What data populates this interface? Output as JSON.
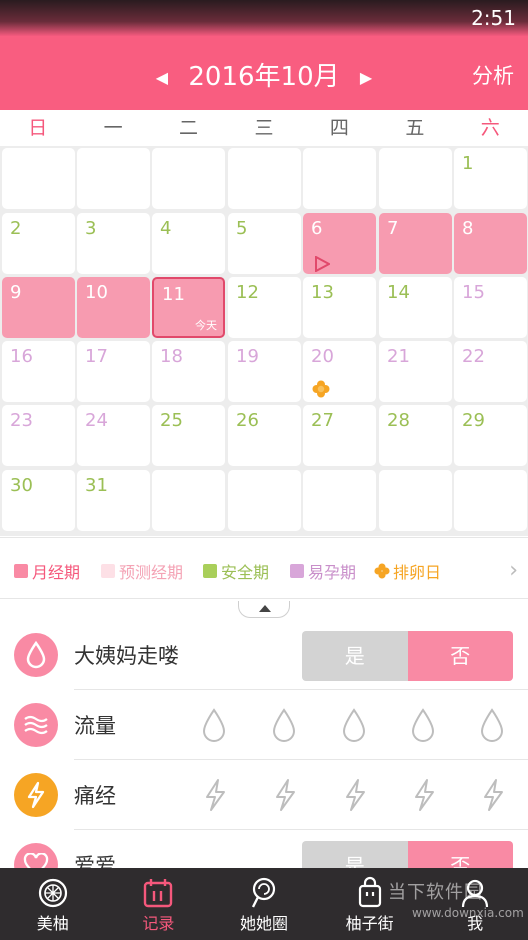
{
  "status_bar": {
    "time": "2:51"
  },
  "header": {
    "prev": "◀",
    "title": "2016年10月",
    "next": "▶",
    "analysis": "分析"
  },
  "weekdays": [
    "日",
    "一",
    "二",
    "三",
    "四",
    "五",
    "六"
  ],
  "calendar": {
    "today_label": "今天",
    "cells": [
      {
        "day": "1",
        "type": "green"
      },
      {
        "day": "2",
        "type": "green"
      },
      {
        "day": "3",
        "type": "green"
      },
      {
        "day": "4",
        "type": "green"
      },
      {
        "day": "5",
        "type": "green"
      },
      {
        "day": "6",
        "type": "period",
        "flag": true
      },
      {
        "day": "7",
        "type": "period"
      },
      {
        "day": "8",
        "type": "period"
      },
      {
        "day": "9",
        "type": "period"
      },
      {
        "day": "10",
        "type": "period"
      },
      {
        "day": "11",
        "type": "period",
        "today": true
      },
      {
        "day": "12",
        "type": "green"
      },
      {
        "day": "13",
        "type": "green"
      },
      {
        "day": "14",
        "type": "green"
      },
      {
        "day": "15",
        "type": "purple"
      },
      {
        "day": "16",
        "type": "purple"
      },
      {
        "day": "17",
        "type": "purple"
      },
      {
        "day": "18",
        "type": "purple"
      },
      {
        "day": "19",
        "type": "purple"
      },
      {
        "day": "20",
        "type": "purple",
        "ovulation": true
      },
      {
        "day": "21",
        "type": "purple"
      },
      {
        "day": "22",
        "type": "purple"
      },
      {
        "day": "23",
        "type": "purple"
      },
      {
        "day": "24",
        "type": "purple"
      },
      {
        "day": "25",
        "type": "green"
      },
      {
        "day": "26",
        "type": "green"
      },
      {
        "day": "27",
        "type": "green"
      },
      {
        "day": "28",
        "type": "green"
      },
      {
        "day": "29",
        "type": "green"
      },
      {
        "day": "30",
        "type": "green"
      },
      {
        "day": "31",
        "type": "green"
      }
    ]
  },
  "legend": {
    "items": [
      {
        "label": "月经期",
        "color": "#f98aa4",
        "text_color": "#f5587c"
      },
      {
        "label": "预测经期",
        "color": "#fde0e6",
        "text_color": "#f4a3b5"
      },
      {
        "label": "安全期",
        "color": "#a9cf5a",
        "text_color": "#9bbf55"
      },
      {
        "label": "易孕期",
        "color": "#d8a6d9",
        "text_color": "#c98fca"
      },
      {
        "label": "排卵日",
        "color": "#f6a524",
        "text_color": "#f6a524",
        "icon": "flower-icon"
      }
    ],
    "more_icon": "›"
  },
  "records": {
    "period": {
      "label": "大姨妈走喽",
      "icon": "drop-icon",
      "color": "#f98aa4",
      "yes": "是",
      "no": "否"
    },
    "flow": {
      "label": "流量",
      "icon": "waves-icon",
      "color": "#f98aa4",
      "levels": 5
    },
    "pain": {
      "label": "痛经",
      "icon": "lightning-icon",
      "color": "#f6a524",
      "levels": 5
    },
    "love": {
      "label": "爱爱",
      "icon": "heart-icon",
      "color": "#f98aa4",
      "yes": "是",
      "no": "否"
    }
  },
  "tabbar": {
    "items": [
      {
        "label": "美柚",
        "icon": "grapefruit-icon"
      },
      {
        "label": "记录",
        "icon": "calendar-icon",
        "active": true
      },
      {
        "label": "她她圈",
        "icon": "lollipop-icon"
      },
      {
        "label": "柚子街",
        "icon": "shopping-bag-icon"
      },
      {
        "label": "我",
        "icon": "user-icon"
      }
    ]
  },
  "watermark": {
    "title": "当下软件园",
    "url": "www.downxia.com"
  }
}
